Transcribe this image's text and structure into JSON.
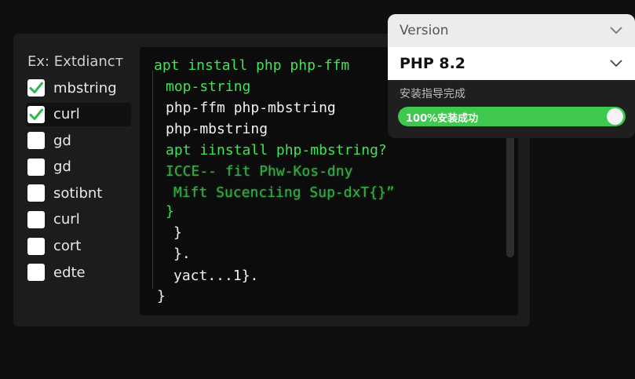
{
  "extensions": {
    "title": "Ex: Extdiancт",
    "items": [
      {
        "label": "mbstring",
        "checked": true
      },
      {
        "label": "curl",
        "checked": true
      },
      {
        "label": "gd",
        "checked": false
      },
      {
        "label": "gd",
        "checked": false
      },
      {
        "label": "sotibnt",
        "checked": false
      },
      {
        "label": "curl",
        "checked": false
      },
      {
        "label": "cort",
        "checked": false
      },
      {
        "label": "edte",
        "checked": false
      }
    ]
  },
  "terminal": {
    "lines": [
      "apt install php php-ffm",
      "mop-string",
      "php-ffm php-mbstring",
      "php-mbstring",
      "apt iinstall php-mbstring?",
      "ICCE-- fit Phw-Kos-dny",
      "Mift Sucenciing Sup-dxT{}”",
      "}",
      "}",
      "}.",
      "yact...1}.",
      "}"
    ]
  },
  "version_panel": {
    "header_label": "Version",
    "selected_version": "PHP 8.2",
    "install_status": "安装指导完成",
    "progress_label": "100%安装成功",
    "progress_value": 100
  },
  "colors": {
    "accent_green": "#3ec84d",
    "terminal_green": "#45e05a"
  },
  "icons": {
    "checkbox_checked": "check-icon",
    "dropdown": "chevron-down-icon"
  }
}
